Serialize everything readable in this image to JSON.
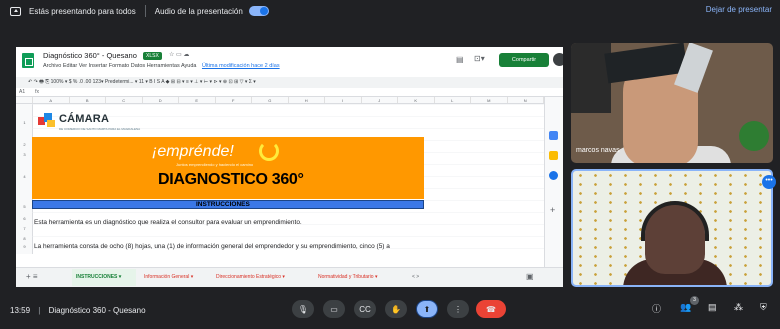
{
  "topbar": {
    "presenting_text": "Estás presentando para todos",
    "audio_text": "Audio de la presentación",
    "stop_label": "Dejar de presentar"
  },
  "sheet": {
    "doc_title": "Diagnóstico 360° - Quesano",
    "badge": "XLSX",
    "menu": [
      "Archivo",
      "Editar",
      "Ver",
      "Insertar",
      "Formato",
      "Datos",
      "Herramientas",
      "Ayuda"
    ],
    "last_edit": "Última modificación hace 2 días",
    "share_label": "Compartir",
    "toolbar_text": "↶ ↷ 🖶 ⎘   100% ▾   $  %  .0  .00  123▾   Predetermi... ▾   11  ▾   B  I  S  A   ◆  ⊞  ⊟ ▾   ≡ ▾  ⊥ ▾  ⊢ ▾  ⊳ ▾   ⊕  ⊡  ⊞  ▽ ▾  Σ ▾",
    "cell_ref": "A1",
    "columns": [
      "A",
      "B",
      "C",
      "D",
      "E",
      "F",
      "G",
      "H",
      "I",
      "J",
      "K",
      "L",
      "M",
      "N"
    ],
    "rows": [
      "1",
      "2",
      "3",
      "4",
      "5",
      "6",
      "7",
      "8",
      "9",
      "10"
    ],
    "camara_title": "CÁMARA",
    "camara_sub": "DE COMERCIO DE SANTO MARTA PARA EL MAGDALENA",
    "emprende": "¡emprénde!",
    "emprende_sub": "Juntos emprendiendo y haciendo el camino",
    "diagnostico": "DIAGNOSTICO 360°",
    "instrucciones": "INSTRUCCIONES",
    "line1": "Esta herramienta es un diagnóstico que realiza el consultor para evaluar un emprendimiento.",
    "line2": "La herramienta consta de ocho (8) hojas, una (1) de información general del emprendedor y su emprendimiento, cinco (5) a",
    "tabs": [
      "INSTRUCCIONES ▾",
      "Información General ▾",
      "Direccionamiento Estratégico ▾",
      "Normatividad y Tributario ▾"
    ]
  },
  "participants": {
    "p1_name": "marcos navas"
  },
  "bottombar": {
    "time": "13:59",
    "meeting": "Diagnóstico 360 - Quesano",
    "people_count": "3"
  },
  "colors": {
    "accent": "#8ab4f8",
    "sheets_green": "#188038",
    "orange": "#ff9800",
    "end_call": "#ea4335"
  }
}
